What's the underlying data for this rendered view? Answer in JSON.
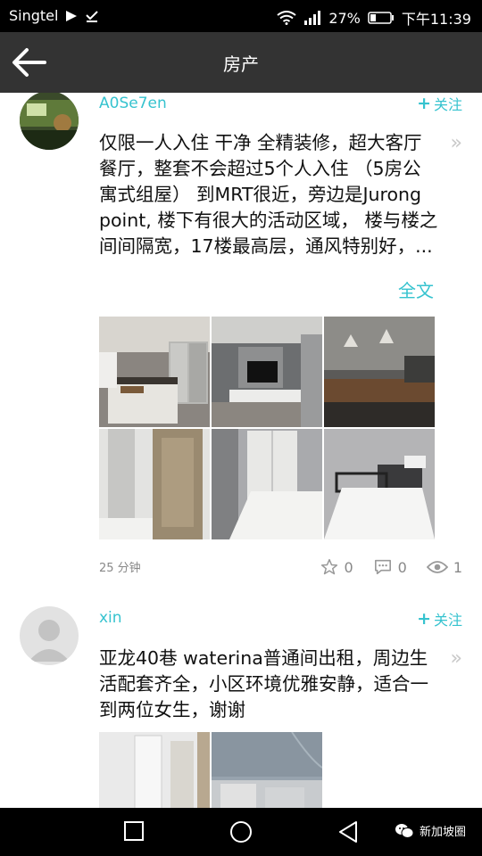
{
  "status_bar": {
    "carrier": "Singtel",
    "battery_percent": "27%",
    "time": "下午11:39"
  },
  "header": {
    "title": "房产"
  },
  "posts": [
    {
      "username": "A0Se7en",
      "follow_label": "关注",
      "text": "仅限一人入住 干净 全精装修，超大客厅 餐厅，整套不会超过5个人入住 （5房公寓式组屋） 到MRT很近，旁边是Jurong point, 楼下有很大的活动区域， 楼与楼之间间隔宽，17楼最高层，通风特别好，...",
      "full_text_label": "全文",
      "time_ago": "25 分钟",
      "likes": "0",
      "comments": "0",
      "views": "1"
    },
    {
      "username": "xin",
      "follow_label": "关注",
      "text": "亚龙40巷 waterina普通间出租，周边生活配套齐全，小区环境优雅安静，适合一到两位女生，谢谢"
    }
  ],
  "watermark": "新加坡圈"
}
